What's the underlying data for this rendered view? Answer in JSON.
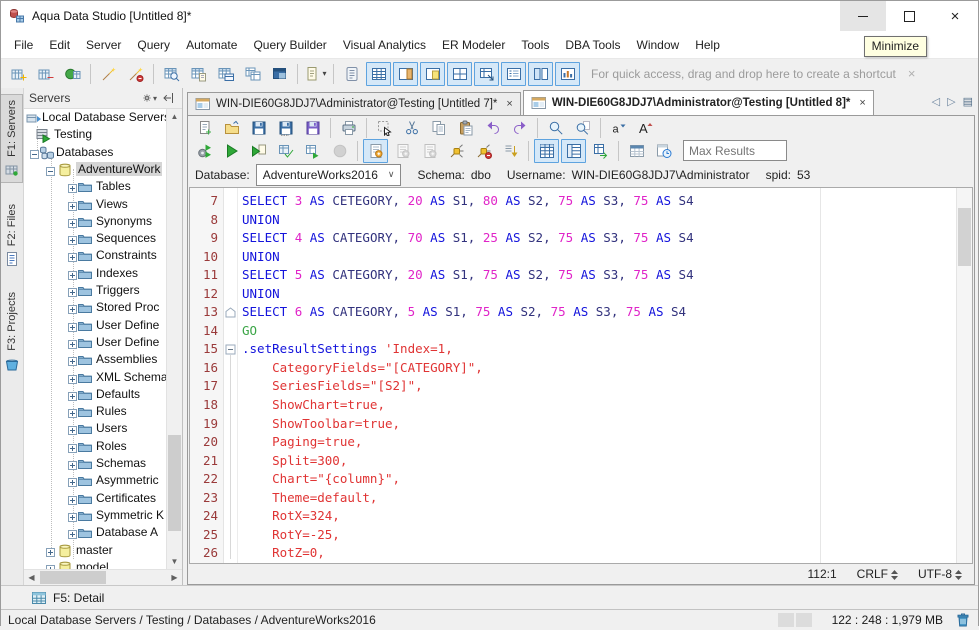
{
  "window": {
    "title": "Aqua Data Studio [Untitled 8]*",
    "minimize_tooltip": "Minimize"
  },
  "menu": {
    "items": [
      "File",
      "Edit",
      "Server",
      "Query",
      "Automate",
      "Query Builder",
      "Visual Analytics",
      "ER Modeler",
      "Tools",
      "DBA Tools",
      "Window",
      "Help"
    ]
  },
  "main_toolbar": {
    "hint": "For quick access, drag and drop here to create a shortcut",
    "hint_close": "×",
    "items": [
      {
        "name": "register-server-button",
        "icon": "server-add"
      },
      {
        "name": "unregister-server-button",
        "icon": "server-remove"
      },
      {
        "name": "connect-server-button",
        "icon": "server-connect"
      },
      {
        "sep": true
      },
      {
        "name": "alter-object-button",
        "icon": "wizard"
      },
      {
        "name": "drop-object-button",
        "icon": "wizard-off"
      },
      {
        "sep": true
      },
      {
        "name": "browse-table-button",
        "icon": "table-find"
      },
      {
        "name": "script-object-button",
        "icon": "table-script"
      },
      {
        "name": "view-ddl-button",
        "icon": "table-view"
      },
      {
        "name": "copy-table-button",
        "icon": "table-copy"
      },
      {
        "name": "table-properties-button",
        "icon": "table-dark"
      },
      {
        "sep": true
      },
      {
        "name": "new-query-analyzer-button",
        "icon": "doc-dropdown",
        "caret": true
      },
      {
        "sep": true
      },
      {
        "name": "open-script-button",
        "icon": "script-scroll"
      },
      {
        "name": "toggle-results-grid-button",
        "icon": "view-grid",
        "toggled": true
      },
      {
        "name": "toggle-right-panel-button",
        "icon": "view-panel-right",
        "toggled": true
      },
      {
        "name": "toggle-editor-panel-button",
        "icon": "view-panel-yellow",
        "toggled": true
      },
      {
        "name": "toggle-grid-layout-button",
        "icon": "view-grid4",
        "toggled": true
      },
      {
        "name": "toggle-detail-window-button",
        "icon": "view-grid-arrow",
        "toggled": true
      },
      {
        "name": "toggle-list-view-button",
        "icon": "view-list",
        "toggled": true
      },
      {
        "name": "toggle-split-view-button",
        "icon": "view-panes",
        "toggled": true
      },
      {
        "name": "toggle-chart-view-button",
        "icon": "view-chart",
        "toggled": true
      }
    ]
  },
  "sidebar": {
    "panel_title": "Servers",
    "strip": [
      {
        "label": "F1: Servers",
        "icon": "strip-servers",
        "active": true
      },
      {
        "label": "F2: Files",
        "icon": "strip-files",
        "active": false
      },
      {
        "label": "F3: Projects",
        "icon": "strip-projects",
        "active": false
      }
    ],
    "tree": [
      {
        "label": "Local Database Servers",
        "level": 0,
        "icon": "tr-root",
        "box": null,
        "selected": false
      },
      {
        "label": "Testing",
        "level": 1,
        "icon": "tr-server",
        "box": null,
        "selected": false
      },
      {
        "label": "Databases",
        "level": 2,
        "icon": "tr-databases",
        "box": "minus",
        "selected": false
      },
      {
        "label": "AdventureWork",
        "level": 3,
        "icon": "tr-db",
        "box": "minus",
        "selected": true
      },
      {
        "label": "Tables",
        "level": 4,
        "icon": "tr-folder",
        "box": "plus",
        "selected": false
      },
      {
        "label": "Views",
        "level": 4,
        "icon": "tr-folder",
        "box": "plus",
        "selected": false
      },
      {
        "label": "Synonyms",
        "level": 4,
        "icon": "tr-folder",
        "box": "plus",
        "selected": false
      },
      {
        "label": "Sequences",
        "level": 4,
        "icon": "tr-folder",
        "box": "plus",
        "selected": false
      },
      {
        "label": "Constraints",
        "level": 4,
        "icon": "tr-folder",
        "box": "plus",
        "selected": false
      },
      {
        "label": "Indexes",
        "level": 4,
        "icon": "tr-folder",
        "box": "plus",
        "selected": false
      },
      {
        "label": "Triggers",
        "level": 4,
        "icon": "tr-folder",
        "box": "plus",
        "selected": false
      },
      {
        "label": "Stored Proc",
        "level": 4,
        "icon": "tr-folder",
        "box": "plus",
        "selected": false
      },
      {
        "label": "User Define",
        "level": 4,
        "icon": "tr-folder",
        "box": "plus",
        "selected": false
      },
      {
        "label": "User Define",
        "level": 4,
        "icon": "tr-folder",
        "box": "plus",
        "selected": false
      },
      {
        "label": "Assemblies",
        "level": 4,
        "icon": "tr-folder",
        "box": "plus",
        "selected": false
      },
      {
        "label": "XML Schema",
        "level": 4,
        "icon": "tr-folder",
        "box": "plus",
        "selected": false
      },
      {
        "label": "Defaults",
        "level": 4,
        "icon": "tr-folder",
        "box": "plus",
        "selected": false
      },
      {
        "label": "Rules",
        "level": 4,
        "icon": "tr-folder",
        "box": "plus",
        "selected": false
      },
      {
        "label": "Users",
        "level": 4,
        "icon": "tr-folder",
        "box": "plus",
        "selected": false
      },
      {
        "label": "Roles",
        "level": 4,
        "icon": "tr-folder",
        "box": "plus",
        "selected": false
      },
      {
        "label": "Schemas",
        "level": 4,
        "icon": "tr-folder",
        "box": "plus",
        "selected": false
      },
      {
        "label": "Asymmetric",
        "level": 4,
        "icon": "tr-folder",
        "box": "plus",
        "selected": false
      },
      {
        "label": "Certificates",
        "level": 4,
        "icon": "tr-folder",
        "box": "plus",
        "selected": false
      },
      {
        "label": "Symmetric K",
        "level": 4,
        "icon": "tr-folder",
        "box": "plus",
        "selected": false
      },
      {
        "label": "Database A",
        "level": 4,
        "icon": "tr-folder",
        "box": "plus",
        "selected": false
      },
      {
        "label": "master",
        "level": 3,
        "icon": "tr-db",
        "box": "plus",
        "selected": false
      },
      {
        "label": "model",
        "level": 3,
        "icon": "tr-db",
        "box": "plus",
        "selected": false
      }
    ],
    "bottom_tab": {
      "label": "F5: Detail"
    }
  },
  "editor": {
    "tabs": [
      {
        "label": "WIN-DIE60G8JDJ7\\Administrator@Testing [Untitled 7]*",
        "active": false
      },
      {
        "label": "WIN-DIE60G8JDJ7\\Administrator@Testing [Untitled 8]*",
        "active": true
      }
    ],
    "tab_close": "×",
    "nav": {
      "prev": "◁",
      "next": "▷",
      "list": "▤"
    },
    "toolbar": {
      "max_results_placeholder": "Max Results",
      "row1": [
        {
          "name": "new-file-button",
          "icon": "new-doc"
        },
        {
          "name": "open-file-button",
          "icon": "open-folder"
        },
        {
          "name": "save-button",
          "icon": "save"
        },
        {
          "name": "save-as-button",
          "icon": "save-as"
        },
        {
          "name": "save-all-button",
          "icon": "save-all"
        },
        {
          "sep": true
        },
        {
          "name": "print-button",
          "icon": "print"
        },
        {
          "sep": true
        },
        {
          "name": "select-button",
          "icon": "select-cursor"
        },
        {
          "name": "cut-button",
          "icon": "cut"
        },
        {
          "name": "copy-button",
          "icon": "copy"
        },
        {
          "name": "paste-button",
          "icon": "paste"
        },
        {
          "name": "undo-button",
          "icon": "undo"
        },
        {
          "name": "redo-button",
          "icon": "redo"
        },
        {
          "sep": true
        },
        {
          "name": "find-button",
          "icon": "find"
        },
        {
          "name": "find-in-files-button",
          "icon": "find-all"
        },
        {
          "sep": true
        },
        {
          "name": "decrease-font-button",
          "icon": "font-dec"
        },
        {
          "name": "increase-font-button",
          "icon": "font-inc"
        }
      ],
      "row2": [
        {
          "name": "execute-explain-button",
          "icon": "exec-explain"
        },
        {
          "name": "execute-button",
          "icon": "exec"
        },
        {
          "name": "execute-script-button",
          "icon": "exec-script"
        },
        {
          "name": "execute-edit-button",
          "icon": "exec-edit"
        },
        {
          "name": "execute-parallel-button",
          "icon": "exec-grid"
        },
        {
          "name": "stop-button",
          "icon": "stop",
          "disabled": true
        },
        {
          "sep": true
        },
        {
          "name": "query-buffer-1-button",
          "icon": "buffer",
          "toggled": true
        },
        {
          "name": "query-buffer-2-button",
          "icon": "buffer-gray",
          "disabled": true
        },
        {
          "name": "query-buffer-3-button",
          "icon": "buffer-gray",
          "disabled": true
        },
        {
          "name": "connect-button",
          "icon": "connect-plug"
        },
        {
          "name": "disconnect-button",
          "icon": "disconnect-plug"
        },
        {
          "name": "send-to-button",
          "icon": "send-down"
        },
        {
          "sep": true
        },
        {
          "name": "results-grid-toggle",
          "icon": "result-grid2",
          "toggled": true
        },
        {
          "name": "results-pivot-toggle",
          "icon": "result-tree",
          "toggled": true
        },
        {
          "name": "results-export-button",
          "icon": "result-export"
        },
        {
          "sep": true
        },
        {
          "name": "describe-button",
          "icon": "schedule-grid"
        },
        {
          "name": "history-button",
          "icon": "history-clock"
        }
      ]
    },
    "connection": {
      "database_label": "Database:",
      "database_value": "AdventureWorks2016",
      "schema_label": "Schema:",
      "schema_value": "dbo",
      "username_label": "Username:",
      "username_value": "WIN-DIE60G8JDJ7\\Administrator",
      "spid_label": "spid:",
      "spid_value": "53"
    },
    "code": {
      "lines": [
        {
          "n": 7,
          "f": null,
          "s": [
            [
              "SELECT ",
              "kw"
            ],
            [
              "3 ",
              "num"
            ],
            [
              "AS ",
              "kw"
            ],
            [
              "CETEGORY, ",
              "id"
            ],
            [
              "20 ",
              "num"
            ],
            [
              "AS ",
              "kw"
            ],
            [
              "S1, ",
              "id"
            ],
            [
              "80 ",
              "num"
            ],
            [
              "AS ",
              "kw"
            ],
            [
              "S2, ",
              "id"
            ],
            [
              "75 ",
              "num"
            ],
            [
              "AS ",
              "kw"
            ],
            [
              "S3, ",
              "id"
            ],
            [
              "75 ",
              "num"
            ],
            [
              "AS ",
              "kw"
            ],
            [
              "S4",
              "id"
            ]
          ]
        },
        {
          "n": 8,
          "f": null,
          "s": [
            [
              "UNION",
              "kw"
            ]
          ]
        },
        {
          "n": 9,
          "f": null,
          "s": [
            [
              "SELECT ",
              "kw"
            ],
            [
              "4 ",
              "num"
            ],
            [
              "AS ",
              "kw"
            ],
            [
              "CATEGORY, ",
              "id"
            ],
            [
              "70 ",
              "num"
            ],
            [
              "AS ",
              "kw"
            ],
            [
              "S1, ",
              "id"
            ],
            [
              "25 ",
              "num"
            ],
            [
              "AS ",
              "kw"
            ],
            [
              "S2, ",
              "id"
            ],
            [
              "75 ",
              "num"
            ],
            [
              "AS ",
              "kw"
            ],
            [
              "S3, ",
              "id"
            ],
            [
              "75 ",
              "num"
            ],
            [
              "AS ",
              "kw"
            ],
            [
              "S4",
              "id"
            ]
          ]
        },
        {
          "n": 10,
          "f": null,
          "s": [
            [
              "UNION",
              "kw"
            ]
          ]
        },
        {
          "n": 11,
          "f": null,
          "s": [
            [
              "SELECT ",
              "kw"
            ],
            [
              "5 ",
              "num"
            ],
            [
              "AS ",
              "kw"
            ],
            [
              "CATEGORY, ",
              "id"
            ],
            [
              "20 ",
              "num"
            ],
            [
              "AS ",
              "kw"
            ],
            [
              "S1, ",
              "id"
            ],
            [
              "75 ",
              "num"
            ],
            [
              "AS ",
              "kw"
            ],
            [
              "S2, ",
              "id"
            ],
            [
              "75 ",
              "num"
            ],
            [
              "AS ",
              "kw"
            ],
            [
              "S3, ",
              "id"
            ],
            [
              "75 ",
              "num"
            ],
            [
              "AS ",
              "kw"
            ],
            [
              "S4",
              "id"
            ]
          ]
        },
        {
          "n": 12,
          "f": null,
          "s": [
            [
              "UNION",
              "kw"
            ]
          ]
        },
        {
          "n": 13,
          "f": "end",
          "s": [
            [
              "SELECT ",
              "kw"
            ],
            [
              "6 ",
              "num"
            ],
            [
              "AS ",
              "kw"
            ],
            [
              "CATEGORY, ",
              "id"
            ],
            [
              "5 ",
              "num"
            ],
            [
              "AS ",
              "kw"
            ],
            [
              "S1, ",
              "id"
            ],
            [
              "75 ",
              "num"
            ],
            [
              "AS ",
              "kw"
            ],
            [
              "S2, ",
              "id"
            ],
            [
              "75 ",
              "num"
            ],
            [
              "AS ",
              "kw"
            ],
            [
              "S3, ",
              "id"
            ],
            [
              "75 ",
              "num"
            ],
            [
              "AS ",
              "kw"
            ],
            [
              "S4",
              "id"
            ]
          ]
        },
        {
          "n": 14,
          "f": null,
          "s": [
            [
              "GO",
              "go"
            ]
          ]
        },
        {
          "n": 15,
          "f": "open",
          "s": [
            [
              ".setResultSettings ",
              "kw"
            ],
            [
              "'Index=1,",
              "str"
            ]
          ]
        },
        {
          "n": 16,
          "f": null,
          "s": [
            [
              "    CategoryFields=\"[CATEGORY]\",",
              "str"
            ]
          ]
        },
        {
          "n": 17,
          "f": null,
          "s": [
            [
              "    SeriesFields=\"[S2]\",",
              "str"
            ]
          ]
        },
        {
          "n": 18,
          "f": null,
          "s": [
            [
              "    ShowChart=true,",
              "str"
            ]
          ]
        },
        {
          "n": 19,
          "f": null,
          "s": [
            [
              "    ShowToolbar=true,",
              "str"
            ]
          ]
        },
        {
          "n": 20,
          "f": null,
          "s": [
            [
              "    Paging=true,",
              "str"
            ]
          ]
        },
        {
          "n": 21,
          "f": null,
          "s": [
            [
              "    Split=300,",
              "str"
            ]
          ]
        },
        {
          "n": 22,
          "f": null,
          "s": [
            [
              "    Chart=\"{column}\",",
              "str"
            ]
          ]
        },
        {
          "n": 23,
          "f": null,
          "s": [
            [
              "    Theme=default,",
              "str"
            ]
          ]
        },
        {
          "n": 24,
          "f": null,
          "s": [
            [
              "    RotX=324,",
              "str"
            ]
          ]
        },
        {
          "n": 25,
          "f": null,
          "s": [
            [
              "    RotY=-25,",
              "str"
            ]
          ]
        },
        {
          "n": 26,
          "f": null,
          "s": [
            [
              "    RotZ=0,",
              "str"
            ]
          ]
        }
      ]
    },
    "status": {
      "position": "112:1",
      "line_ending": "CRLF",
      "encoding": "UTF-8"
    }
  },
  "statusbar": {
    "breadcrumb": "Local Database Servers / Testing / Databases / AdventureWorks2016",
    "memory": "122 : 248 : 1,979 MB"
  }
}
